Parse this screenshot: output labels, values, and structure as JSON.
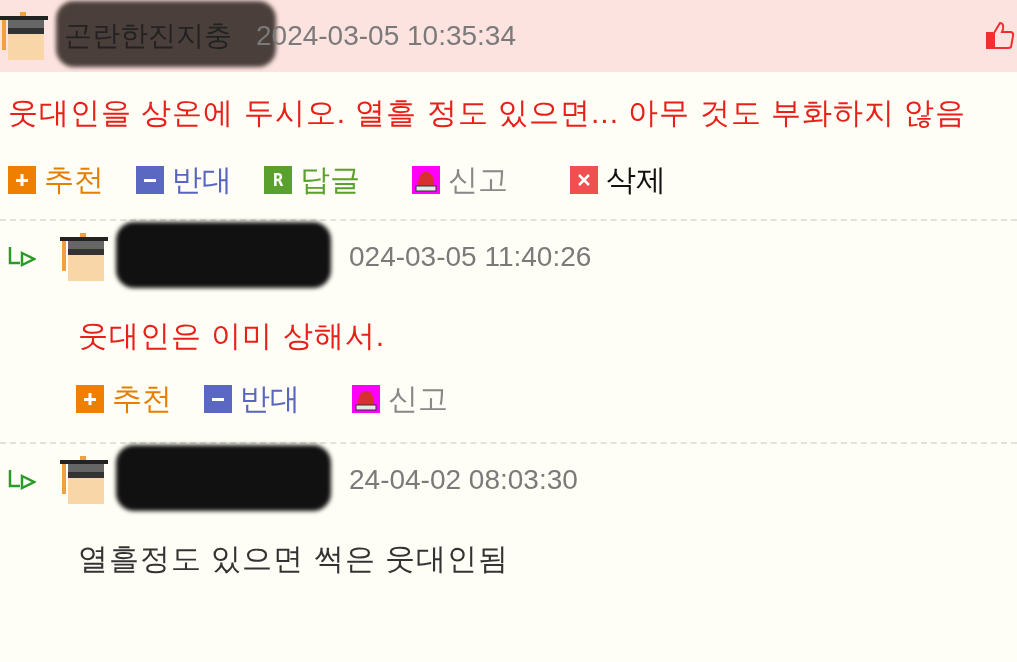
{
  "comments": [
    {
      "is_reply": false,
      "best": true,
      "name": "곤란한진지충",
      "time": "2024-03-05 10:35:34",
      "color": "#e8201a",
      "body": "웃대인을 상온에 두시오. 열흘 정도 있으면... 아무 것도 부화하지 않음",
      "actions": [
        {
          "kind": "recommend",
          "label": "추천"
        },
        {
          "kind": "oppose",
          "label": "반대"
        },
        {
          "kind": "reply",
          "label": "답글",
          "icon_text": "R"
        },
        {
          "kind": "report",
          "label": "신고"
        },
        {
          "kind": "delete",
          "label": "삭제"
        }
      ]
    },
    {
      "is_reply": true,
      "best": false,
      "time": "024-03-05 11:40:26",
      "color": "#e8201a",
      "body": "웃대인은 이미 상해서.",
      "actions": [
        {
          "kind": "recommend",
          "label": "추천"
        },
        {
          "kind": "oppose",
          "label": "반대"
        },
        {
          "kind": "report",
          "label": "신고"
        }
      ]
    },
    {
      "is_reply": true,
      "best": false,
      "time": "24-04-02 08:03:30",
      "color": "#333333",
      "body": "열흘정도 있으면 썩은 웃대인됨"
    }
  ]
}
